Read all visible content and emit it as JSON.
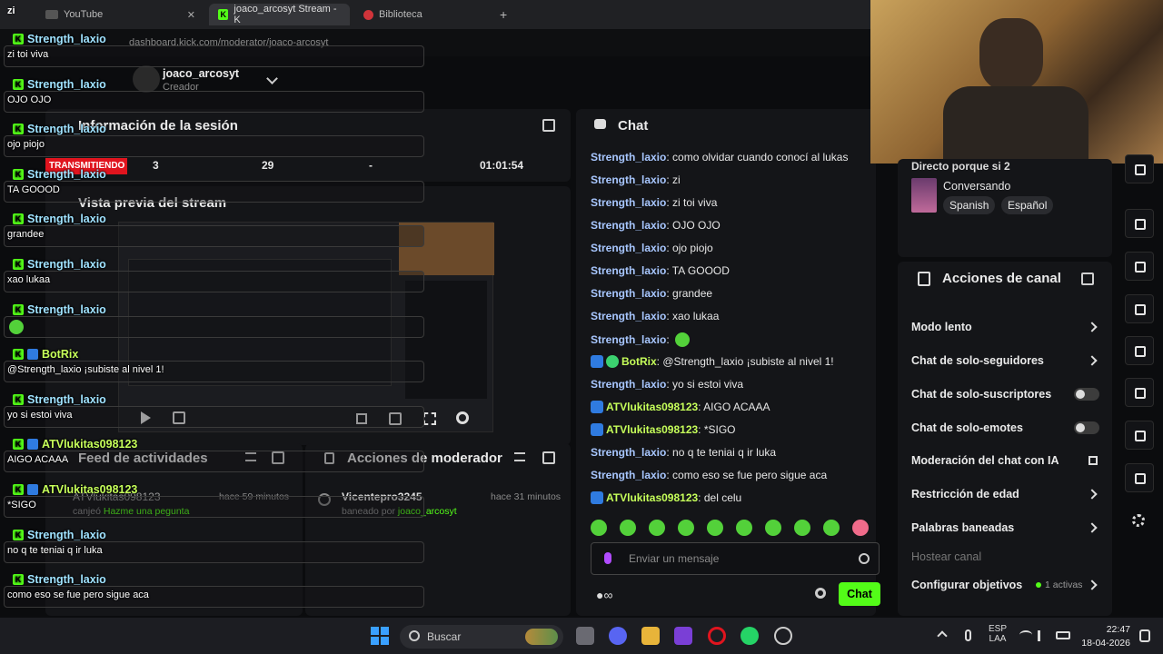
{
  "browser": {
    "tabs": [
      {
        "label": "YouTube"
      },
      {
        "label": "joaco_arcosyt Stream - K"
      },
      {
        "label": "Biblioteca"
      }
    ],
    "url": "dashboard.kick.com/moderator/joaco-arcosyt"
  },
  "header": {
    "channel_name": "joaco_arcosyt",
    "role": "Creador",
    "beta": "BETA"
  },
  "session": {
    "title": "Información de la sesión",
    "status": "TRANSMITIENDO",
    "stats": [
      "3",
      "29",
      "-",
      "01:01:54"
    ]
  },
  "preview": {
    "title": "Vista previa del stream"
  },
  "activity": {
    "title": "Feed de actividades",
    "user": "ATVlukitas098123",
    "time": "hace 59 minutos",
    "action": "canjeó",
    "reward": "Hazme una pegunta"
  },
  "mod_actions": {
    "title": "Acciones de moderador",
    "user": "Vicentepro3245",
    "time": "hace 31 minutos",
    "action": "baneado por",
    "by": "joaco_arcosyt"
  },
  "chat": {
    "title": "Chat",
    "messages": [
      {
        "user": "Strength_laxio",
        "text": ": como olvidar cuando conocí al lukas"
      },
      {
        "user": "Strength_laxio",
        "text": ": zi"
      },
      {
        "user": "Strength_laxio",
        "text": ": zi toi viva"
      },
      {
        "user": "Strength_laxio",
        "text": ": OJO OJO"
      },
      {
        "user": "Strength_laxio",
        "text": ": ojo piojo"
      },
      {
        "user": "Strength_laxio",
        "text": ": TA GOOOD"
      },
      {
        "user": "Strength_laxio",
        "text": ": grandee"
      },
      {
        "user": "Strength_laxio",
        "text": ": xao lukaa"
      },
      {
        "user": "Strength_laxio",
        "text": ":"
      },
      {
        "user": "BotRix",
        "text": ": @Strength_laxio ¡subiste al nivel 1!"
      },
      {
        "user": "Strength_laxio",
        "text": ": yo si estoi viva"
      },
      {
        "user": "ATVlukitas098123",
        "text": ": AIGO ACAAA"
      },
      {
        "user": "ATVlukitas098123",
        "text": ": *SIGO"
      },
      {
        "user": "Strength_laxio",
        "text": ": no q te teniai q ir luka"
      },
      {
        "user": "Strength_laxio",
        "text": ": como eso se fue pero sigue aca"
      },
      {
        "user": "ATVlukitas098123",
        "text": ": del celu"
      }
    ],
    "input_placeholder": "Enviar un mensaje",
    "send_label": "Chat"
  },
  "stream_info": {
    "title": "Directo porque si 2",
    "category": "Conversando",
    "tags": [
      "Spanish",
      "Español"
    ]
  },
  "channel_actions": {
    "title": "Acciones de canal",
    "items": [
      {
        "label": "Modo lento"
      },
      {
        "label": "Chat de solo-seguidores"
      },
      {
        "label": "Chat de solo-suscriptores"
      },
      {
        "label": "Chat de solo-emotes"
      },
      {
        "label": "Moderación del chat con IA"
      },
      {
        "label": "Restricción de edad"
      },
      {
        "label": "Palabras baneadas"
      },
      {
        "label": "Hostear canal"
      },
      {
        "label": "Configurar objetivos"
      }
    ],
    "goals_active": "1 activas"
  },
  "overlay": {
    "top_text": "zi",
    "messages": [
      {
        "user": "Strength_laxio",
        "text": "zi toi viva"
      },
      {
        "user": "Strength_laxio",
        "text": "OJO OJO"
      },
      {
        "user": "Strength_laxio",
        "text": "ojo piojo"
      },
      {
        "user": "Strength_laxio",
        "text": "TA GOOOD"
      },
      {
        "user": "Strength_laxio",
        "text": "grandee"
      },
      {
        "user": "Strength_laxio",
        "text": "xao lukaa"
      },
      {
        "user": "Strength_laxio",
        "text": ""
      },
      {
        "user": "BotRix",
        "text": "@Strength_laxio ¡subiste al nivel 1!"
      },
      {
        "user": "Strength_laxio",
        "text": "yo si estoi viva"
      },
      {
        "user": "ATVlukitas098123",
        "text": "AIGO ACAAA"
      },
      {
        "user": "ATVlukitas098123",
        "text": "*SIGO"
      },
      {
        "user": "Strength_laxio",
        "text": "no q te teniai q ir luka"
      },
      {
        "user": "Strength_laxio",
        "text": "como eso se fue pero sigue aca"
      },
      {
        "user": "ATVlukitas098123",
        "text": "del celu"
      }
    ]
  },
  "taskbar": {
    "search": "Buscar",
    "lang": "ESP",
    "layout": "LAA",
    "time": "22:47",
    "date": "18-04-2026"
  },
  "colors": {
    "kick_green": "#53fc18",
    "username_blue": "#a8c7ff",
    "username_green": "#c6ff5a",
    "live_red": "#e0141e"
  }
}
